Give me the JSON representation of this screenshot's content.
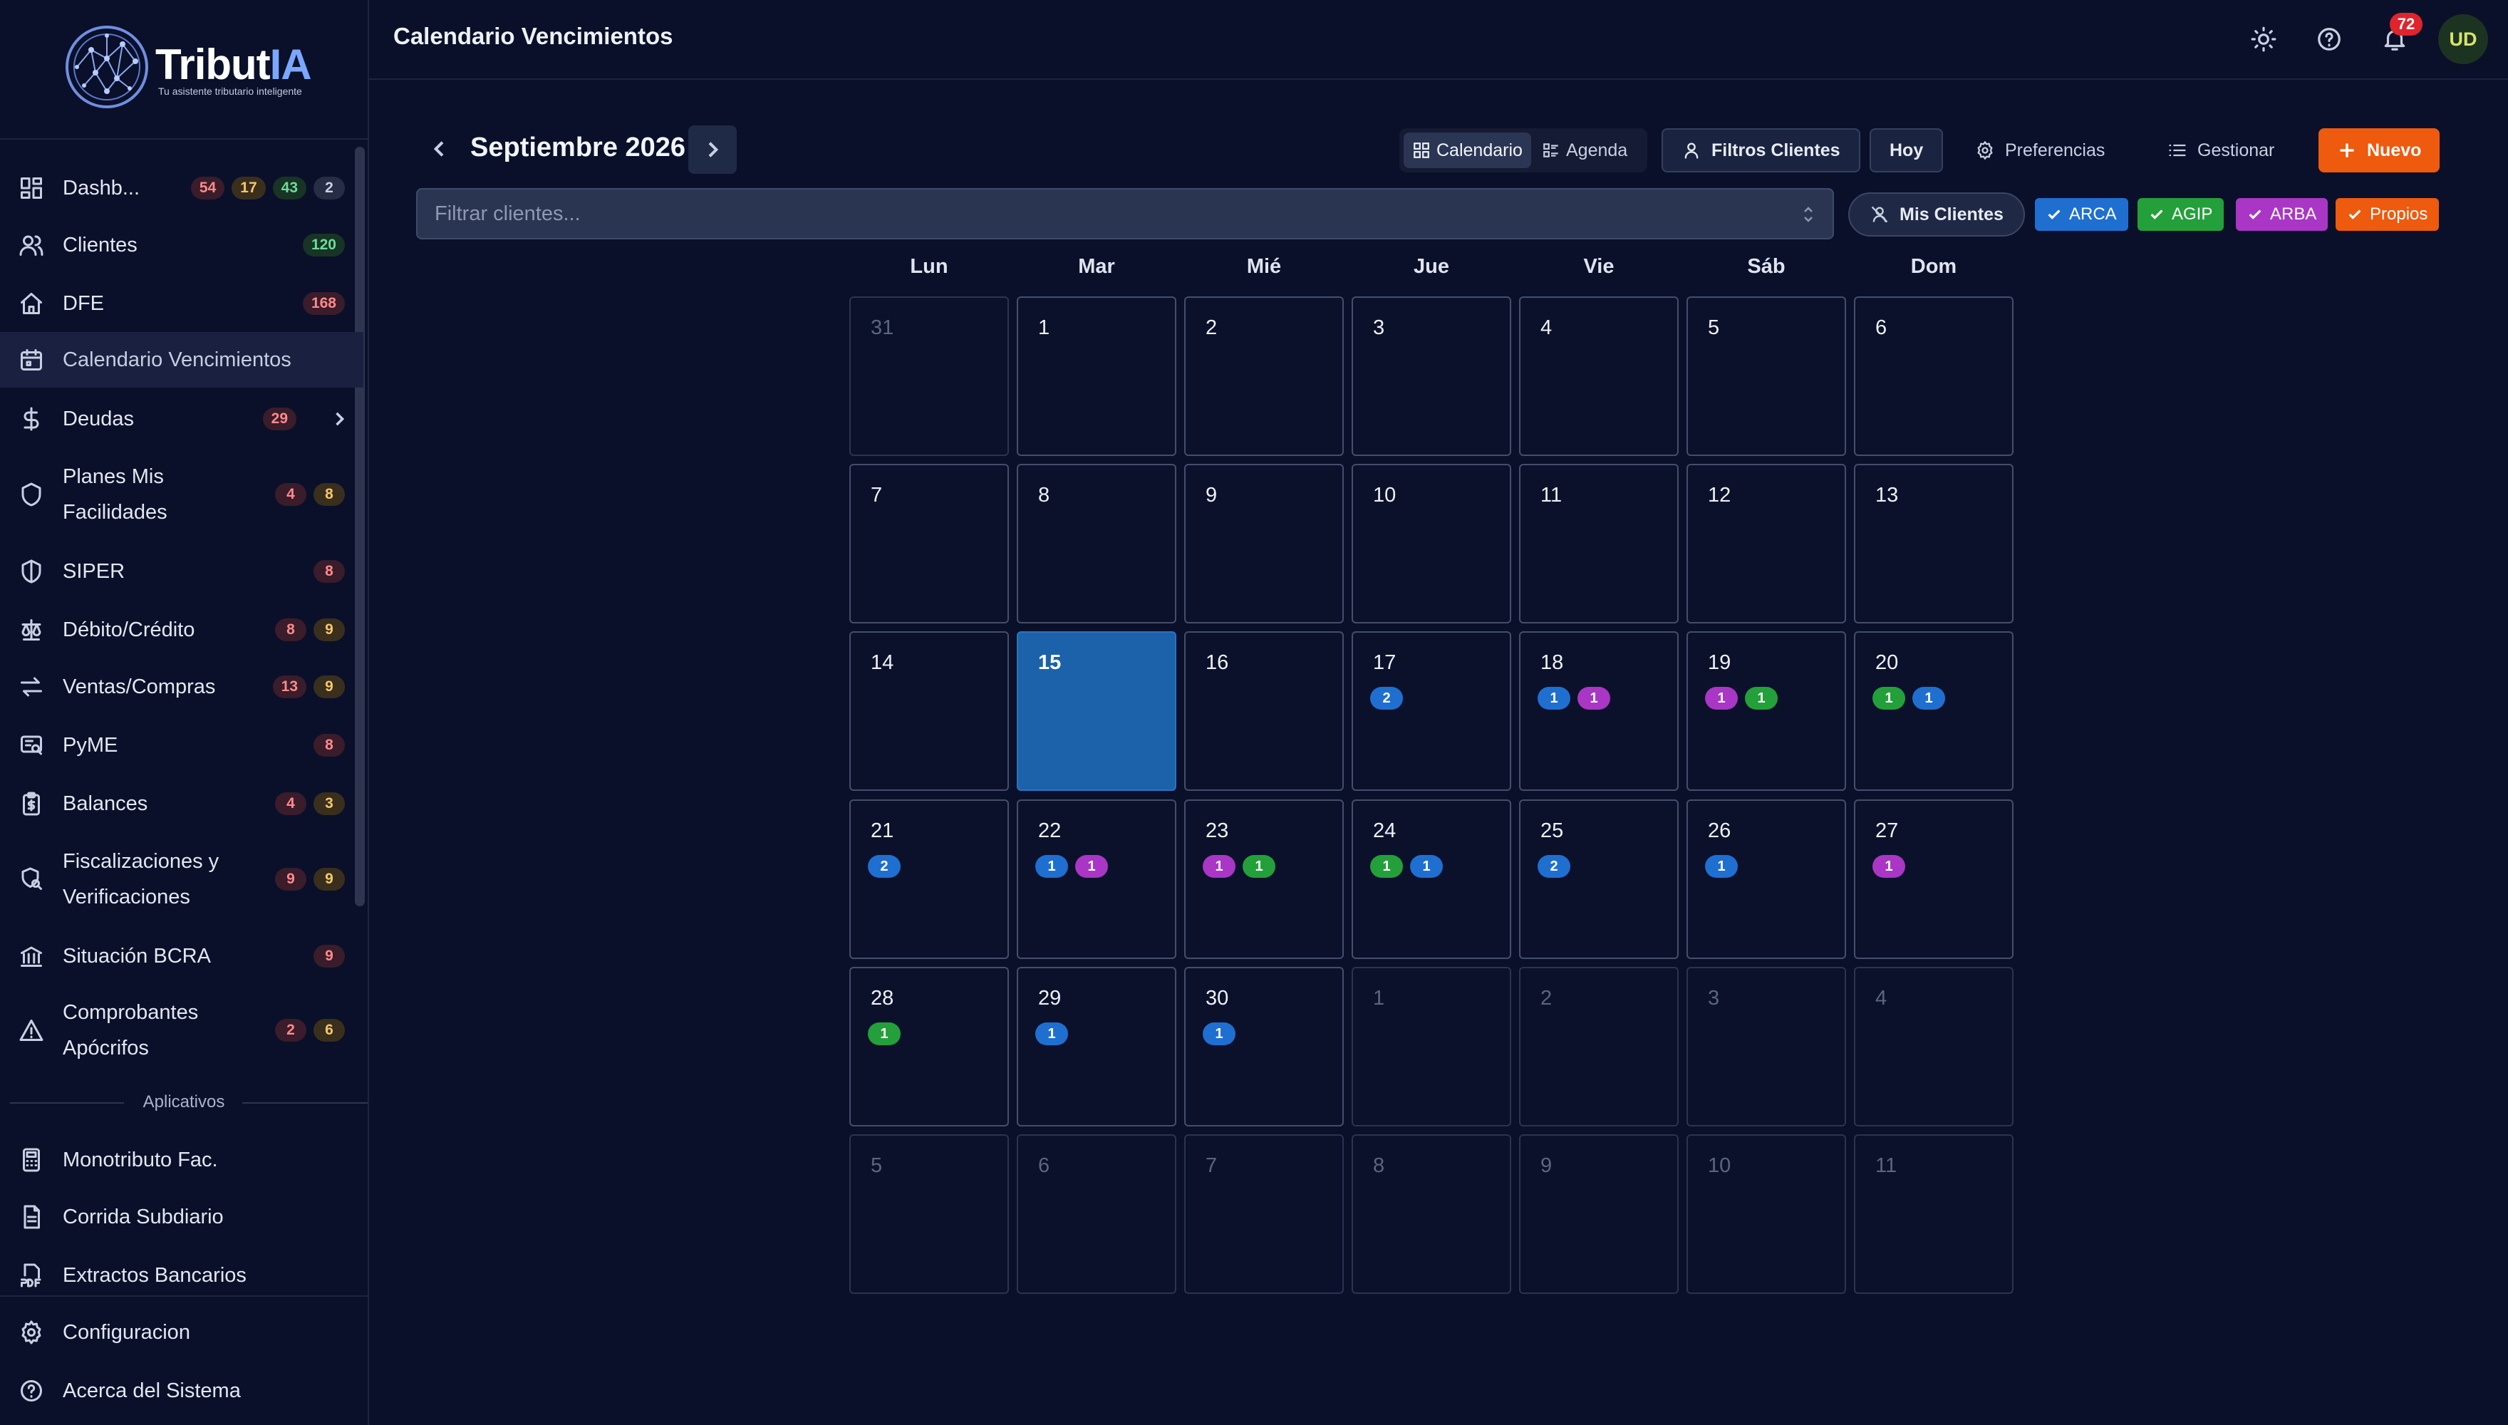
{
  "colors": {
    "arca": "#1f6fd1",
    "agip": "#23a03a",
    "arba": "#a936c5",
    "propios": "#ee5a0e"
  },
  "brand": {
    "name_main": "Tribut",
    "name_accent": "IA",
    "tagline": "Tu asistente tributario inteligente"
  },
  "sidebar": {
    "items": [
      {
        "label": "Dashb...",
        "icon": "dashboard-icon",
        "badges": [
          "54",
          "17",
          "43",
          "2"
        ]
      },
      {
        "label": "Clientes",
        "icon": "users-icon",
        "badges": [
          "120"
        ]
      },
      {
        "label": "DFE",
        "icon": "home-icon",
        "badges": [
          "168"
        ]
      },
      {
        "label": "Calendario Vencimientos",
        "icon": "calendar-icon",
        "badges": []
      },
      {
        "label": "Deudas",
        "icon": "dollar-icon",
        "badges": [
          "29"
        ]
      },
      {
        "label": "Planes Mis Facilidades",
        "line1": "Planes Mis",
        "line2": "Facilidades",
        "icon": "shield-icon",
        "badges": [
          "4",
          "8"
        ]
      },
      {
        "label": "SIPER",
        "icon": "shield-half-icon",
        "badges": [
          "8"
        ]
      },
      {
        "label": "Débito/Crédito",
        "icon": "scale-icon",
        "badges": [
          "8",
          "9"
        ]
      },
      {
        "label": "Ventas/Compras",
        "icon": "arrows-exchange-icon",
        "badges": [
          "13",
          "9"
        ]
      },
      {
        "label": "PyME",
        "icon": "receipt-search-icon",
        "badges": [
          "8"
        ]
      },
      {
        "label": "Balances",
        "icon": "clipboard-dollar-icon",
        "badges": [
          "4",
          "3"
        ]
      },
      {
        "label": "Fiscalizaciones y Verificaciones",
        "line1": "Fiscalizaciones y",
        "line2": "Verificaciones",
        "icon": "search-shield-icon",
        "badges": [
          "9",
          "9"
        ]
      },
      {
        "label": "Situación BCRA",
        "icon": "bank-icon",
        "badges": [
          "9"
        ]
      },
      {
        "label": "Comprobantes Apócrifos",
        "line1": "Comprobantes",
        "line2": "Apócrifos",
        "icon": "warning-icon",
        "badges": [
          "2",
          "6"
        ]
      }
    ],
    "apps_label": "Aplicativos",
    "apps": [
      {
        "label": "Monotributo Fac.",
        "icon": "calculator-icon"
      },
      {
        "label": "Corrida Subdiario",
        "icon": "document-icon"
      },
      {
        "label": "Extractos Bancarios",
        "icon": "pdf-icon"
      }
    ],
    "bottom": [
      {
        "label": "Configuracion",
        "icon": "gear-icon"
      },
      {
        "label": "Acerca del Sistema",
        "icon": "help-icon"
      }
    ]
  },
  "header": {
    "title": "Calendario Vencimientos",
    "notifications": "72",
    "avatar": "UD"
  },
  "toolbar": {
    "month": "Septiembre 2026",
    "view_calendar": "Calendario",
    "view_agenda": "Agenda",
    "filters": "Filtros Clientes",
    "today": "Hoy",
    "preferences": "Preferencias",
    "manage": "Gestionar",
    "new": "Nuevo",
    "filter_placeholder": "Filtrar clientes...",
    "my_clients": "Mis Clientes",
    "chips": [
      "ARCA",
      "AGIP",
      "ARBA",
      "Propios"
    ]
  },
  "calendar": {
    "weekdays": [
      "Lun",
      "Mar",
      "Mié",
      "Jue",
      "Vie",
      "Sáb",
      "Dom"
    ],
    "weeks": [
      [
        {
          "d": "31",
          "o": true
        },
        {
          "d": "1"
        },
        {
          "d": "2"
        },
        {
          "d": "3"
        },
        {
          "d": "4"
        },
        {
          "d": "5"
        },
        {
          "d": "6"
        }
      ],
      [
        {
          "d": "7"
        },
        {
          "d": "8"
        },
        {
          "d": "9"
        },
        {
          "d": "10"
        },
        {
          "d": "11"
        },
        {
          "d": "12"
        },
        {
          "d": "13"
        }
      ],
      [
        {
          "d": "14"
        },
        {
          "d": "15",
          "today": true
        },
        {
          "d": "16"
        },
        {
          "d": "17",
          "ev": [
            {
              "c": "arca",
              "n": "2"
            }
          ]
        },
        {
          "d": "18",
          "ev": [
            {
              "c": "arca",
              "n": "1"
            },
            {
              "c": "arba",
              "n": "1"
            }
          ]
        },
        {
          "d": "19",
          "ev": [
            {
              "c": "arba",
              "n": "1"
            },
            {
              "c": "agip",
              "n": "1"
            }
          ]
        },
        {
          "d": "20",
          "ev": [
            {
              "c": "agip",
              "n": "1"
            },
            {
              "c": "arca",
              "n": "1"
            }
          ]
        }
      ],
      [
        {
          "d": "21",
          "ev": [
            {
              "c": "arca",
              "n": "2"
            }
          ]
        },
        {
          "d": "22",
          "ev": [
            {
              "c": "arca",
              "n": "1"
            },
            {
              "c": "arba",
              "n": "1"
            }
          ]
        },
        {
          "d": "23",
          "ev": [
            {
              "c": "arba",
              "n": "1"
            },
            {
              "c": "agip",
              "n": "1"
            }
          ]
        },
        {
          "d": "24",
          "ev": [
            {
              "c": "agip",
              "n": "1"
            },
            {
              "c": "arca",
              "n": "1"
            }
          ]
        },
        {
          "d": "25",
          "ev": [
            {
              "c": "arca",
              "n": "2"
            }
          ]
        },
        {
          "d": "26",
          "ev": [
            {
              "c": "arca",
              "n": "1"
            }
          ]
        },
        {
          "d": "27",
          "ev": [
            {
              "c": "arba",
              "n": "1"
            }
          ]
        }
      ],
      [
        {
          "d": "28",
          "ev": [
            {
              "c": "agip",
              "n": "1"
            }
          ]
        },
        {
          "d": "29",
          "ev": [
            {
              "c": "arca",
              "n": "1"
            }
          ]
        },
        {
          "d": "30",
          "ev": [
            {
              "c": "arca",
              "n": "1"
            }
          ]
        },
        {
          "d": "1",
          "o": true
        },
        {
          "d": "2",
          "o": true
        },
        {
          "d": "3",
          "o": true
        },
        {
          "d": "4",
          "o": true
        }
      ],
      [
        {
          "d": "5",
          "o": true
        },
        {
          "d": "6",
          "o": true
        },
        {
          "d": "7",
          "o": true
        },
        {
          "d": "8",
          "o": true
        },
        {
          "d": "9",
          "o": true
        },
        {
          "d": "10",
          "o": true
        },
        {
          "d": "11",
          "o": true
        }
      ]
    ]
  }
}
